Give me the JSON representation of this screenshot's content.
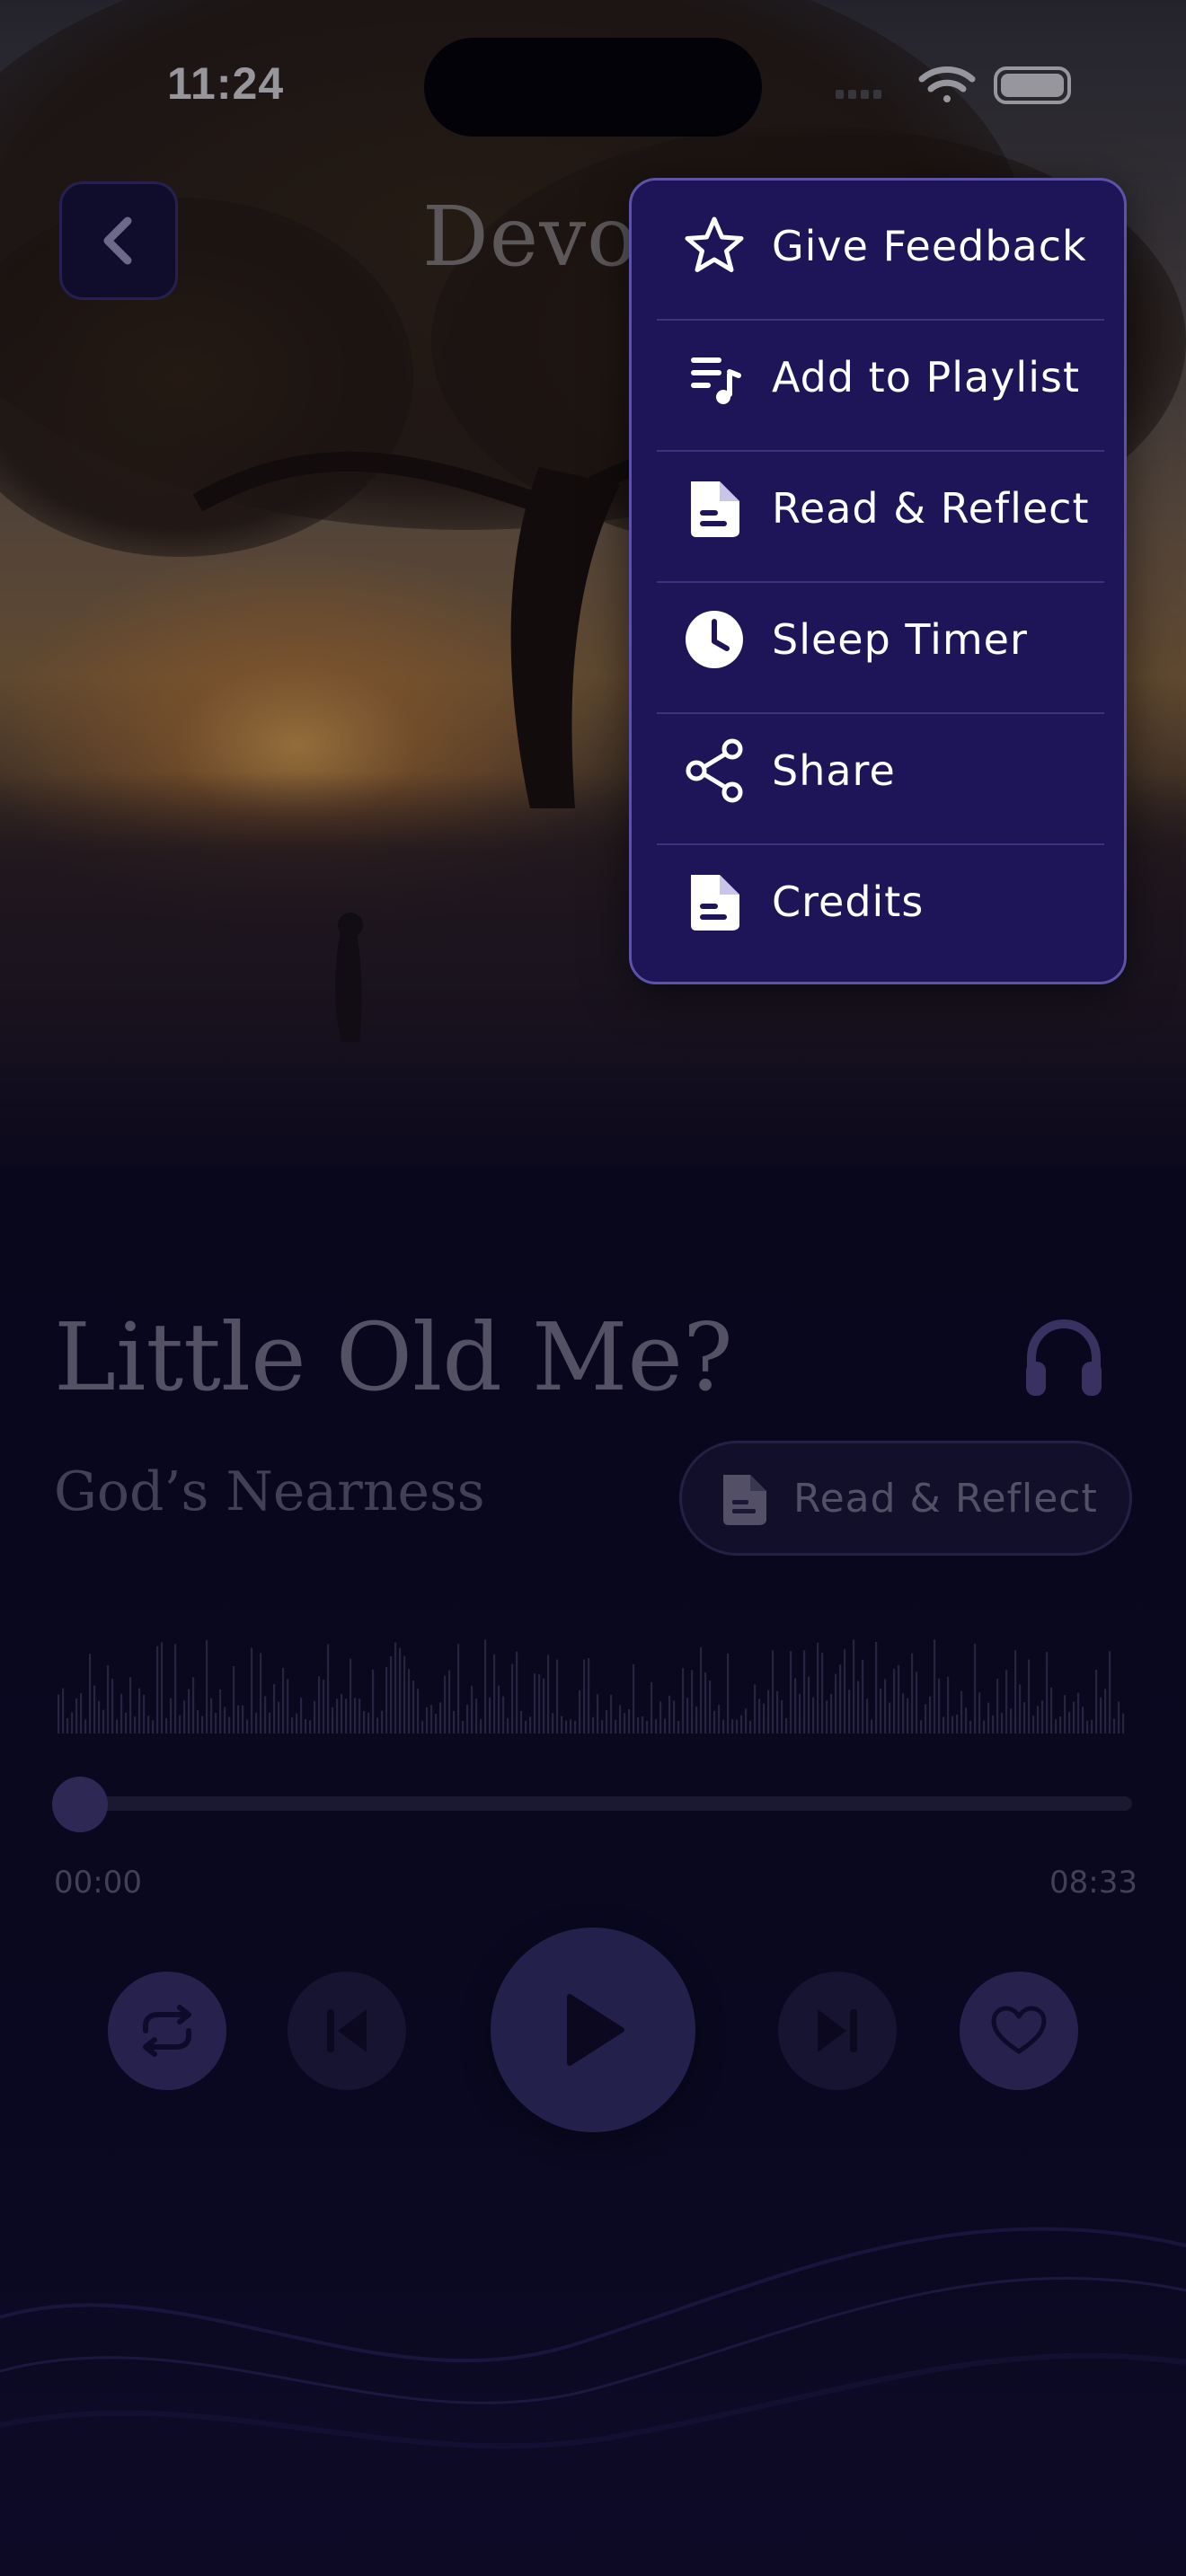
{
  "status_bar": {
    "time": "11:24"
  },
  "header": {
    "title": "Devotional"
  },
  "menu": {
    "items": [
      {
        "label": "Give Feedback",
        "icon": "star-icon"
      },
      {
        "label": "Add to Playlist",
        "icon": "add-to-playlist-icon"
      },
      {
        "label": "Read & Reflect",
        "icon": "document-icon"
      },
      {
        "label": "Sleep Timer",
        "icon": "clock-icon"
      },
      {
        "label": "Share",
        "icon": "share-icon"
      },
      {
        "label": "Credits",
        "icon": "document-icon"
      }
    ]
  },
  "track": {
    "title": "Little Old Me?",
    "subtitle": "God’s Nearness",
    "reflect_button": "Read & Reflect",
    "elapsed": "00:00",
    "duration": "08:33",
    "progress": 0.0
  },
  "colors": {
    "accent": "#4b4386",
    "menu_bg": "#1e1558",
    "menu_border": "#5c52a8"
  }
}
